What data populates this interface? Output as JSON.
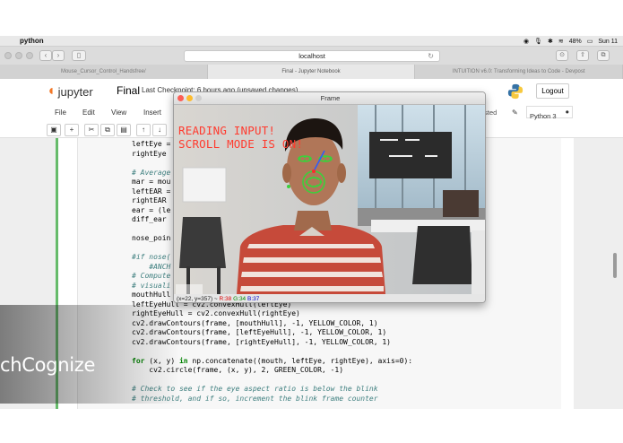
{
  "menubar": {
    "app_name": "python",
    "clock": "Sun 11",
    "battery": "48%"
  },
  "browser": {
    "url": "localhost",
    "tabs": [
      "Mouse_Cursor_Control_Handsfree/",
      "Final - Jupyter Notebook",
      "INTUITION v6.0: Transforming Ideas to Code - Devpost"
    ],
    "active_tab": 1
  },
  "jupyter": {
    "logo_text": "jupyter",
    "notebook_title": "Final",
    "checkpoint": "Last Checkpoint: 6 hours ago",
    "unsaved": "(unsaved changes)",
    "logout_label": "Logout",
    "menu": [
      "File",
      "Edit",
      "View",
      "Insert"
    ],
    "trusted_label": "usted",
    "kernel_label": "Python 3"
  },
  "code": {
    "lines": [
      "leftEye =",
      "rightEye",
      "",
      "# Average",
      "mar = mou",
      "leftEAR =",
      "rightEAR",
      "ear = (le",
      "diff_ear",
      "",
      "nose_poin",
      "",
      "#if nose(",
      "    #ANCH",
      "# Compute",
      "# visuali",
      "mouthHull",
      "leftEyeHull = cv2.convexHull(leftEye)",
      "rightEyeHull = cv2.convexHull(rightEye)",
      "cv2.drawContours(frame, [mouthHull], -1, YELLOW_COLOR, 1)",
      "cv2.drawContours(frame, [leftEyeHull], -1, YELLOW_COLOR, 1)",
      "cv2.drawContours(frame, [rightEyeHull], -1, YELLOW_COLOR, 1)",
      "",
      "for (x, y) in np.concatenate((mouth, leftEye, rightEye), axis=0):",
      "    cv2.circle(frame, (x, y), 2, GREEN_COLOR, -1)",
      "",
      "# Check to see if the eye aspect ratio is below the blink",
      "# threshold, and if so, increment the blink frame counter"
    ]
  },
  "frame_window": {
    "title": "Frame",
    "overlay_line1": "READING INPUT!",
    "overlay_line2": "SCROLL MODE IS ON!",
    "status_coords": "(x=22, y=357) ~",
    "status_r": "R:38",
    "status_g": "G:34",
    "status_b": "B:37"
  },
  "watermark": {
    "text": "chCognize"
  },
  "colors": {
    "jupyter_orange": "#f37726",
    "cell_green": "#66bb6a",
    "overlay_red": "#ff3b2f",
    "tracking_green": "#3cd03c"
  }
}
